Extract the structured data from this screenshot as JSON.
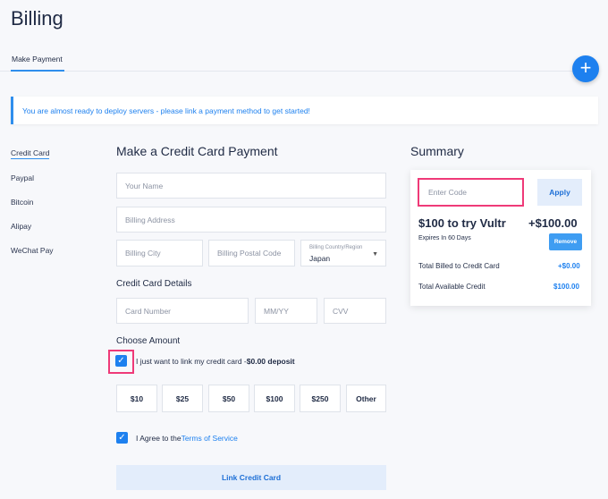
{
  "page": {
    "title": "Billing"
  },
  "tabs": [
    {
      "label": "Make Payment"
    }
  ],
  "alert": {
    "text": "You are almost ready to deploy servers - please link a payment method to get started!"
  },
  "sidebar": {
    "items": [
      {
        "label": "Credit Card"
      },
      {
        "label": "Paypal"
      },
      {
        "label": "Bitcoin"
      },
      {
        "label": "Alipay"
      },
      {
        "label": "WeChat Pay"
      }
    ]
  },
  "form": {
    "title": "Make a Credit Card Payment",
    "name_placeholder": "Your Name",
    "address_placeholder": "Billing Address",
    "city_placeholder": "Billing City",
    "postal_placeholder": "Billing Postal Code",
    "country_label": "Billing Country/Region",
    "country_value": "Japan",
    "card_details_title": "Credit Card Details",
    "card_number_placeholder": "Card Number",
    "expiry_placeholder": "MM/YY",
    "cvv_placeholder": "CVV",
    "choose_amount_title": "Choose Amount",
    "link_only_text": "I just want to link my credit card -",
    "link_only_deposit": "$0.00 deposit",
    "amounts": [
      "$10",
      "$25",
      "$50",
      "$100",
      "$250",
      "Other"
    ],
    "agree_text": "I Agree to the",
    "tos_link": "Terms of Service",
    "submit_label": "Link Credit Card"
  },
  "summary": {
    "title": "Summary",
    "code_placeholder": "Enter Code",
    "apply_label": "Apply",
    "promo_title": "$100 to try Vultr",
    "promo_amount": "+$100.00",
    "promo_expiry": "Expires In 60 Days",
    "remove_label": "Remove",
    "billed_label": "Total Billed to Credit Card",
    "billed_value": "+$0.00",
    "available_label": "Total Available Credit",
    "available_value": "$100.00"
  },
  "colors": {
    "accent": "#1d80ef",
    "highlight": "#ef3a78"
  }
}
